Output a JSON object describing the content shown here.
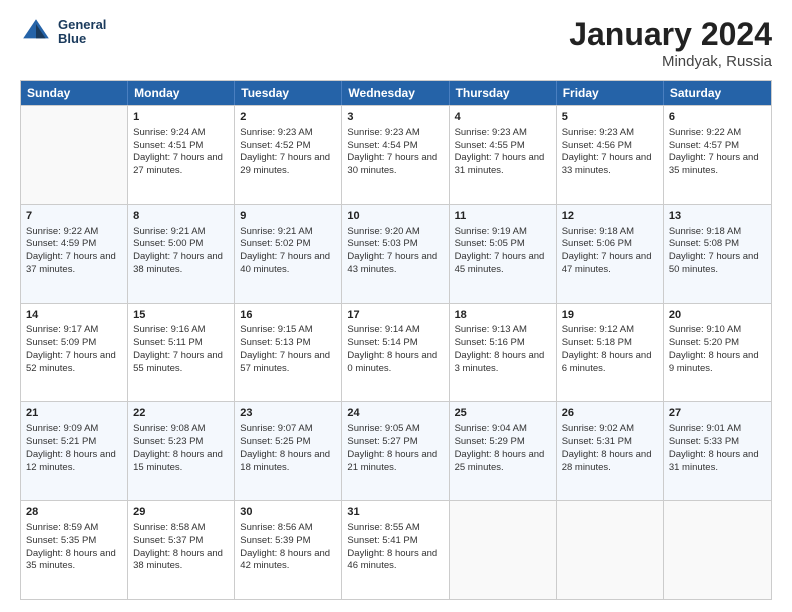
{
  "header": {
    "logo_line1": "General",
    "logo_line2": "Blue",
    "main_title": "January 2024",
    "subtitle": "Mindyak, Russia"
  },
  "weekdays": [
    "Sunday",
    "Monday",
    "Tuesday",
    "Wednesday",
    "Thursday",
    "Friday",
    "Saturday"
  ],
  "weeks": [
    [
      {
        "day": "",
        "sunrise": "",
        "sunset": "",
        "daylight": ""
      },
      {
        "day": "1",
        "sunrise": "Sunrise: 9:24 AM",
        "sunset": "Sunset: 4:51 PM",
        "daylight": "Daylight: 7 hours and 27 minutes."
      },
      {
        "day": "2",
        "sunrise": "Sunrise: 9:23 AM",
        "sunset": "Sunset: 4:52 PM",
        "daylight": "Daylight: 7 hours and 29 minutes."
      },
      {
        "day": "3",
        "sunrise": "Sunrise: 9:23 AM",
        "sunset": "Sunset: 4:54 PM",
        "daylight": "Daylight: 7 hours and 30 minutes."
      },
      {
        "day": "4",
        "sunrise": "Sunrise: 9:23 AM",
        "sunset": "Sunset: 4:55 PM",
        "daylight": "Daylight: 7 hours and 31 minutes."
      },
      {
        "day": "5",
        "sunrise": "Sunrise: 9:23 AM",
        "sunset": "Sunset: 4:56 PM",
        "daylight": "Daylight: 7 hours and 33 minutes."
      },
      {
        "day": "6",
        "sunrise": "Sunrise: 9:22 AM",
        "sunset": "Sunset: 4:57 PM",
        "daylight": "Daylight: 7 hours and 35 minutes."
      }
    ],
    [
      {
        "day": "7",
        "sunrise": "Sunrise: 9:22 AM",
        "sunset": "Sunset: 4:59 PM",
        "daylight": "Daylight: 7 hours and 37 minutes."
      },
      {
        "day": "8",
        "sunrise": "Sunrise: 9:21 AM",
        "sunset": "Sunset: 5:00 PM",
        "daylight": "Daylight: 7 hours and 38 minutes."
      },
      {
        "day": "9",
        "sunrise": "Sunrise: 9:21 AM",
        "sunset": "Sunset: 5:02 PM",
        "daylight": "Daylight: 7 hours and 40 minutes."
      },
      {
        "day": "10",
        "sunrise": "Sunrise: 9:20 AM",
        "sunset": "Sunset: 5:03 PM",
        "daylight": "Daylight: 7 hours and 43 minutes."
      },
      {
        "day": "11",
        "sunrise": "Sunrise: 9:19 AM",
        "sunset": "Sunset: 5:05 PM",
        "daylight": "Daylight: 7 hours and 45 minutes."
      },
      {
        "day": "12",
        "sunrise": "Sunrise: 9:18 AM",
        "sunset": "Sunset: 5:06 PM",
        "daylight": "Daylight: 7 hours and 47 minutes."
      },
      {
        "day": "13",
        "sunrise": "Sunrise: 9:18 AM",
        "sunset": "Sunset: 5:08 PM",
        "daylight": "Daylight: 7 hours and 50 minutes."
      }
    ],
    [
      {
        "day": "14",
        "sunrise": "Sunrise: 9:17 AM",
        "sunset": "Sunset: 5:09 PM",
        "daylight": "Daylight: 7 hours and 52 minutes."
      },
      {
        "day": "15",
        "sunrise": "Sunrise: 9:16 AM",
        "sunset": "Sunset: 5:11 PM",
        "daylight": "Daylight: 7 hours and 55 minutes."
      },
      {
        "day": "16",
        "sunrise": "Sunrise: 9:15 AM",
        "sunset": "Sunset: 5:13 PM",
        "daylight": "Daylight: 7 hours and 57 minutes."
      },
      {
        "day": "17",
        "sunrise": "Sunrise: 9:14 AM",
        "sunset": "Sunset: 5:14 PM",
        "daylight": "Daylight: 8 hours and 0 minutes."
      },
      {
        "day": "18",
        "sunrise": "Sunrise: 9:13 AM",
        "sunset": "Sunset: 5:16 PM",
        "daylight": "Daylight: 8 hours and 3 minutes."
      },
      {
        "day": "19",
        "sunrise": "Sunrise: 9:12 AM",
        "sunset": "Sunset: 5:18 PM",
        "daylight": "Daylight: 8 hours and 6 minutes."
      },
      {
        "day": "20",
        "sunrise": "Sunrise: 9:10 AM",
        "sunset": "Sunset: 5:20 PM",
        "daylight": "Daylight: 8 hours and 9 minutes."
      }
    ],
    [
      {
        "day": "21",
        "sunrise": "Sunrise: 9:09 AM",
        "sunset": "Sunset: 5:21 PM",
        "daylight": "Daylight: 8 hours and 12 minutes."
      },
      {
        "day": "22",
        "sunrise": "Sunrise: 9:08 AM",
        "sunset": "Sunset: 5:23 PM",
        "daylight": "Daylight: 8 hours and 15 minutes."
      },
      {
        "day": "23",
        "sunrise": "Sunrise: 9:07 AM",
        "sunset": "Sunset: 5:25 PM",
        "daylight": "Daylight: 8 hours and 18 minutes."
      },
      {
        "day": "24",
        "sunrise": "Sunrise: 9:05 AM",
        "sunset": "Sunset: 5:27 PM",
        "daylight": "Daylight: 8 hours and 21 minutes."
      },
      {
        "day": "25",
        "sunrise": "Sunrise: 9:04 AM",
        "sunset": "Sunset: 5:29 PM",
        "daylight": "Daylight: 8 hours and 25 minutes."
      },
      {
        "day": "26",
        "sunrise": "Sunrise: 9:02 AM",
        "sunset": "Sunset: 5:31 PM",
        "daylight": "Daylight: 8 hours and 28 minutes."
      },
      {
        "day": "27",
        "sunrise": "Sunrise: 9:01 AM",
        "sunset": "Sunset: 5:33 PM",
        "daylight": "Daylight: 8 hours and 31 minutes."
      }
    ],
    [
      {
        "day": "28",
        "sunrise": "Sunrise: 8:59 AM",
        "sunset": "Sunset: 5:35 PM",
        "daylight": "Daylight: 8 hours and 35 minutes."
      },
      {
        "day": "29",
        "sunrise": "Sunrise: 8:58 AM",
        "sunset": "Sunset: 5:37 PM",
        "daylight": "Daylight: 8 hours and 38 minutes."
      },
      {
        "day": "30",
        "sunrise": "Sunrise: 8:56 AM",
        "sunset": "Sunset: 5:39 PM",
        "daylight": "Daylight: 8 hours and 42 minutes."
      },
      {
        "day": "31",
        "sunrise": "Sunrise: 8:55 AM",
        "sunset": "Sunset: 5:41 PM",
        "daylight": "Daylight: 8 hours and 46 minutes."
      },
      {
        "day": "",
        "sunrise": "",
        "sunset": "",
        "daylight": ""
      },
      {
        "day": "",
        "sunrise": "",
        "sunset": "",
        "daylight": ""
      },
      {
        "day": "",
        "sunrise": "",
        "sunset": "",
        "daylight": ""
      }
    ]
  ]
}
